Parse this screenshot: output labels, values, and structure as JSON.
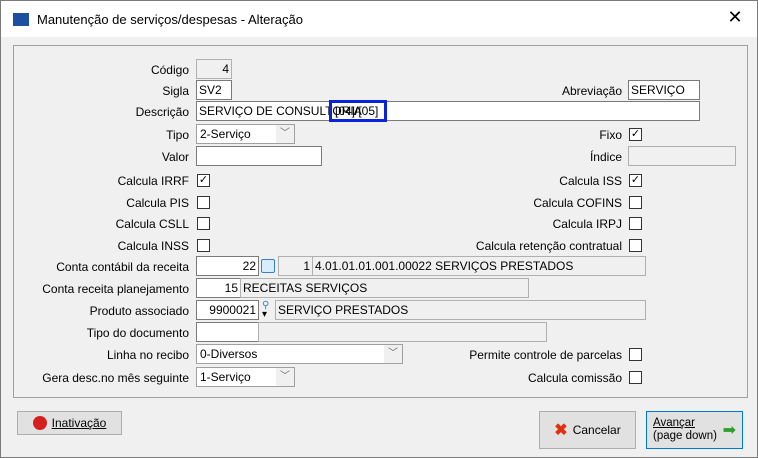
{
  "window": {
    "title": "Manutenção de serviços/despesas - Alteração",
    "close": "✕"
  },
  "form": {
    "codigo": {
      "label": "Código",
      "value": "4"
    },
    "sigla": {
      "label": "Sigla",
      "value": "SV2"
    },
    "abreviacao": {
      "label": "Abreviação",
      "value": "SERVIÇO"
    },
    "descricao": {
      "label": "Descrição",
      "value": "SERVIÇO DE CONSULTORIA",
      "highlight": "[04]/[05]"
    },
    "tipo": {
      "label": "Tipo",
      "value": "2-Serviço"
    },
    "fixo": {
      "label": "Fixo",
      "checked": "✓"
    },
    "valor": {
      "label": "Valor",
      "value": ""
    },
    "indice": {
      "label": "Índice",
      "value": ""
    },
    "irrf": {
      "label": "Calcula IRRF",
      "checked": "✓"
    },
    "iss": {
      "label": "Calcula ISS",
      "checked": "✓"
    },
    "pis": {
      "label": "Calcula PIS"
    },
    "cofins": {
      "label": "Calcula COFINS"
    },
    "csll": {
      "label": "Calcula CSLL"
    },
    "irpj": {
      "label": "Calcula IRPJ"
    },
    "inss": {
      "label": "Calcula INSS"
    },
    "retencao": {
      "label": "Calcula retenção contratual"
    },
    "conta_contabil": {
      "label": "Conta contábil da receita",
      "code": "22",
      "reduzido": "1",
      "desc": "4.01.01.01.001.00022 SERVIÇOS PRESTADOS"
    },
    "conta_plan": {
      "label": "Conta receita planejamento",
      "code": "15",
      "desc": "RECEITAS SERVIÇOS"
    },
    "produto": {
      "label": "Produto associado",
      "code": "9900021",
      "desc": "SERVIÇO PRESTADOS"
    },
    "tipo_doc": {
      "label": "Tipo do documento",
      "code": "",
      "desc": ""
    },
    "linha": {
      "label": "Linha no recibo",
      "value": "0-Diversos"
    },
    "gera": {
      "label": "Gera desc.no mês seguinte",
      "value": "1-Serviço"
    },
    "parcelas": {
      "label": "Permite controle de parcelas"
    },
    "comissao": {
      "label": "Calcula comissão"
    }
  },
  "buttons": {
    "inativacao": "Inativação",
    "cancelar": "Cancelar",
    "avancar1": "Avançar",
    "avancar2": "(page down)"
  }
}
